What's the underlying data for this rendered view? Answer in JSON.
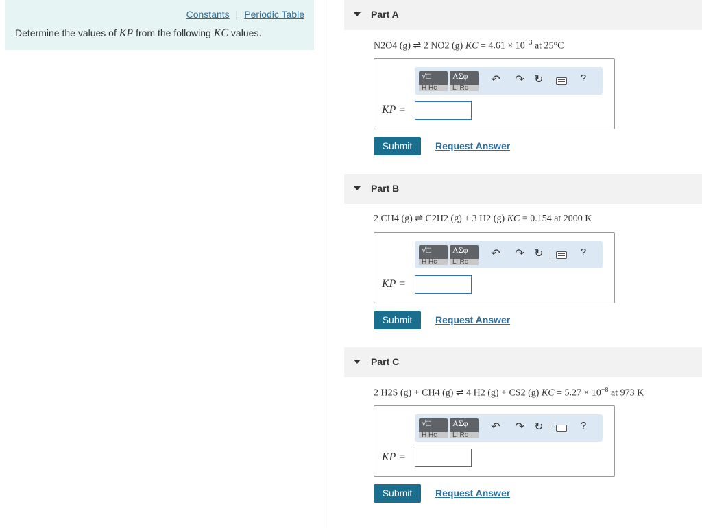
{
  "links": {
    "constants": "Constants",
    "separator": "|",
    "periodic_table": "Periodic Table"
  },
  "intro": {
    "prefix": "Determine the values of ",
    "kp": "KP",
    "middle": " from the following ",
    "kc": "KC",
    "suffix": " values."
  },
  "toolbar": {
    "template1_top": "√□",
    "template1_bottom": "H  Hc",
    "template2_top": "ΑΣφ",
    "template2_bottom": "Li  Ro",
    "undo_icon": "↶",
    "redo_icon": "↷",
    "reset_icon": "↻",
    "help": "?"
  },
  "parts": [
    {
      "title": "Part A",
      "equation": {
        "lhs": "N2O4 (g)",
        "arrow": "⇌",
        "rhs": "2 NO2 (g)",
        "k": "KC",
        "eq": " = 4.61 × 10",
        "exp": "−3",
        "cond": " at 25°C"
      },
      "kp_label": "KP =",
      "input_value": "",
      "submit": "Submit",
      "request": "Request Answer"
    },
    {
      "title": "Part B",
      "equation": {
        "lhs": "2 CH4 (g)",
        "arrow": "⇌",
        "rhs": "C2H2 (g) + 3 H2 (g)",
        "k": "KC",
        "eq": " = 0.154 at 2000 K",
        "exp": "",
        "cond": ""
      },
      "kp_label": "KP =",
      "input_value": "",
      "submit": "Submit",
      "request": "Request Answer"
    },
    {
      "title": "Part C",
      "equation": {
        "lhs": "2 H2S (g) + CH4 (g)",
        "arrow": "⇌",
        "rhs": "4 H2 (g) + CS2 (g)",
        "k": "KC",
        "eq": " = 5.27 × 10",
        "exp": "−8",
        "cond": " at 973 K"
      },
      "kp_label": "KP =",
      "input_value": "",
      "submit": "Submit",
      "request": "Request Answer"
    }
  ]
}
